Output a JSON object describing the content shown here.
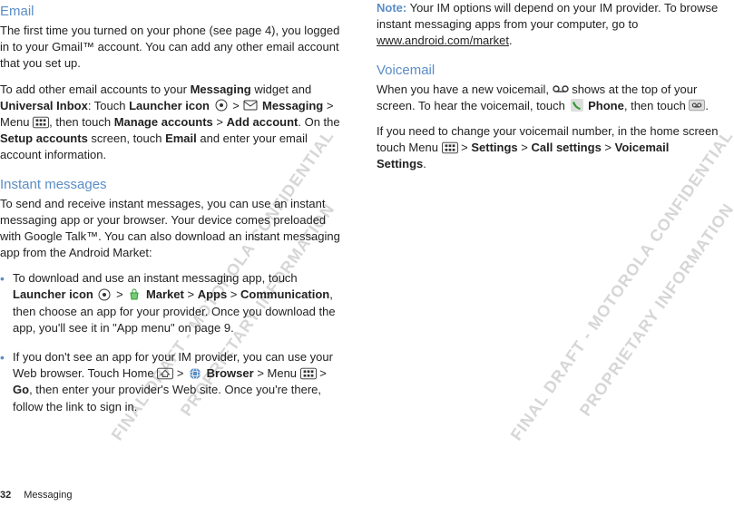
{
  "left": {
    "email": {
      "heading": "Email",
      "p1": "The first time you turned on your phone (see page 4), you logged in to your Gmail™ account. You can add any other email account that you set up.",
      "p2a": "To add other email accounts to your ",
      "p2b": "Messaging",
      "p2c": " widget and ",
      "p2d": "Universal Inbox",
      "p2e": ": Touch ",
      "p2f": "Launcher icon",
      "p2g": " > ",
      "p2h": "Messaging",
      "p2i": " > Menu ",
      "p2j": ", then touch ",
      "p2k": "Manage accounts",
      "p2l": " > ",
      "p2m": "Add account",
      "p2n": ". On the ",
      "p2o": "Setup accounts",
      "p2p": " screen, touch ",
      "p2q": "Email",
      "p2r": " and enter your email account information."
    },
    "im": {
      "heading": "Instant messages",
      "p1": "To send and receive instant messages, you can use an instant messaging app or your browser. Your device comes preloaded with Google Talk™. You can also download an instant messaging app from the Android Market:",
      "b1a": "To download and use an instant messaging app, touch ",
      "b1b": "Launcher icon",
      "b1c": " > ",
      "b1d": "Market",
      "b1e": " > ",
      "b1f": "Apps",
      "b1g": " > ",
      "b1h": "Communication",
      "b1i": ", then choose an app for your provider. Once you download the app, you'll see it in \"App menu\" on page 9.",
      "b2a": "If you don't see an app for your IM provider, you can use your Web browser. Touch Home ",
      "b2b": " > ",
      "b2c": "Browser",
      "b2d": " > Menu ",
      "b2e": " > ",
      "b2f": "Go",
      "b2g": ", then enter your provider's Web site. Once you're there, follow the link to sign in."
    }
  },
  "right": {
    "note": {
      "label": "Note:",
      "text": " Your IM options will depend on your IM provider. To browse instant messaging apps from your computer, go to ",
      "link": "www.android.com/market",
      "end": "."
    },
    "vm": {
      "heading": "Voicemail",
      "p1a": "When you have a new voicemail, ",
      "p1b": " shows at the top of your screen. To hear the voicemail, touch ",
      "p1c": "Phone",
      "p1d": ", then touch ",
      "p1e": ".",
      "p2a": "If you need to change your voicemail number, in the home screen touch Menu ",
      "p2b": " > ",
      "p2c": "Settings",
      "p2d": " > ",
      "p2e": "Call settings",
      "p2f": " > ",
      "p2g": "Voicemail Settings",
      "p2h": "."
    }
  },
  "footer": {
    "page": "32",
    "label": "Messaging"
  },
  "watermark": {
    "line1": "FINAL DRAFT - MOTOROLA CONFIDENTIAL",
    "line2": "PROPRIETARY INFORMATION"
  }
}
